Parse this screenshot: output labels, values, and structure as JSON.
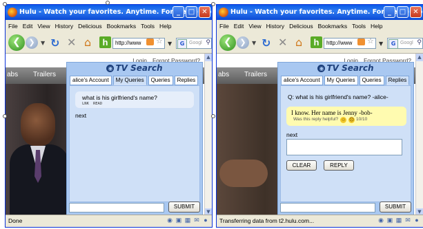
{
  "colors": {
    "titlebar": "#0a5ae8",
    "widget_bg": "#a9c8f1",
    "answer_bg": "#fffbb0",
    "hulu_nav": "#6f6f6f"
  },
  "windows": [
    {
      "title": "Hulu - Watch your favorites. Anytime. For free. - Mo...",
      "menu": [
        "File",
        "Edit",
        "View",
        "History",
        "Delicious",
        "Bookmarks",
        "Tools",
        "Help"
      ],
      "address": "http://www",
      "search_placeholder": "Googl",
      "status": "Done",
      "hulu": {
        "links": [
          "Login",
          "Forgot Password?"
        ],
        "nav": [
          "abs",
          "Trailers"
        ]
      },
      "widget": {
        "logo": "TV Search",
        "tabs": [
          "alice's Account",
          "My Queries",
          "Queries",
          "Replies"
        ],
        "active_tab": "My Queries",
        "question": "what is his girlfriend's name?",
        "meta": [
          "LNK",
          "READ"
        ],
        "next_label": "next",
        "submit": "SUBMIT"
      }
    },
    {
      "title": "Hulu - Watch your favorites. Anytime. For free. - Mo...",
      "menu": [
        "File",
        "Edit",
        "View",
        "History",
        "Delicious",
        "Bookmarks",
        "Tools",
        "Help"
      ],
      "address": "http://www",
      "search_placeholder": "Googl",
      "status": "Transferring data from t2.hulu.com...",
      "hulu": {
        "links": [
          "Login",
          "Forgot Password?"
        ],
        "nav": [
          "abs",
          "Trailers"
        ]
      },
      "widget": {
        "logo": "TV Search",
        "tabs": [
          "alice's Account",
          "My Queries",
          "Queries",
          "Replies"
        ],
        "active_tab": "Replies",
        "question_line": "Q: what is his girlfriend's name? -alice-",
        "answer": "I know. Her name is Jenny -bob-",
        "helpful_prompt": "Was this reply helpful?",
        "helpful_count": "10/10",
        "next_label": "next",
        "clear": "CLEAR",
        "reply": "REPLY",
        "submit": "SUBMIT"
      }
    }
  ]
}
